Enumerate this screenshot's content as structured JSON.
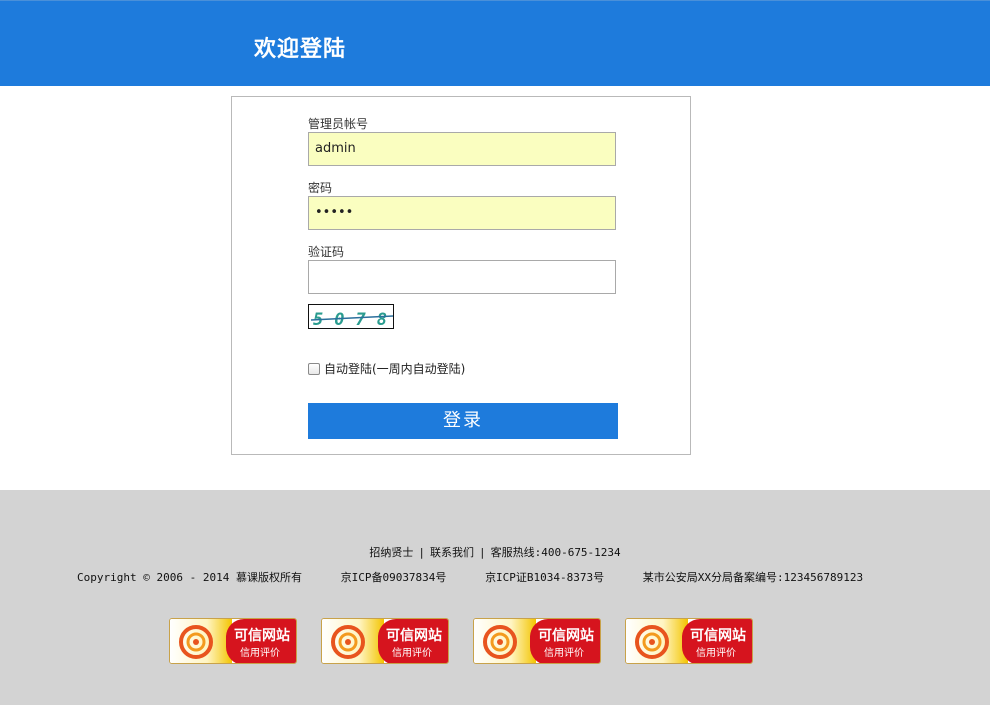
{
  "header": {
    "title": "欢迎登陆"
  },
  "form": {
    "account_label": "管理员帐号",
    "account_value": "admin",
    "password_label": "密码",
    "password_value": "•••••",
    "captcha_label": "验证码",
    "captcha_value": "",
    "captcha_text": "5078",
    "remember_label": "自动登陆(一周内自动登陆)",
    "remember_checked": false,
    "login_button": "登录"
  },
  "footer": {
    "links": [
      "招纳贤士",
      "联系我们",
      "客服热线:400-675-1234"
    ],
    "copyright": "Copyright © 2006 - 2014 慕课版权所有",
    "icp1": "京ICP备09037834号",
    "icp2": "京ICP证B1034-8373号",
    "police": "某市公安局XX分局备案编号:123456789123",
    "badge_title": "可信网站",
    "badge_subtitle": "信用评价"
  },
  "colors": {
    "primary": "#1e7bdc",
    "footer_bg": "#d3d3d3",
    "autofill": "#fafec0",
    "badge_red": "#d6141e"
  }
}
